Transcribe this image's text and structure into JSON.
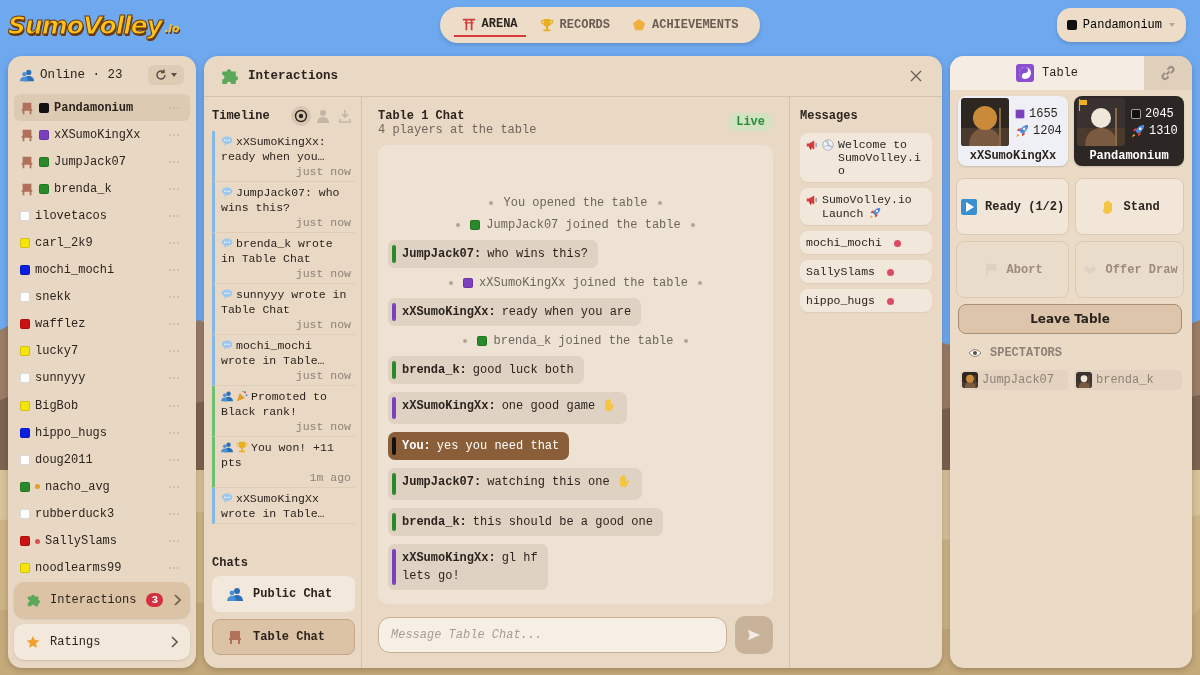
{
  "logo": {
    "name": "SumoVolley",
    "suffix": ".io"
  },
  "nav": [
    {
      "kind": "arena",
      "label": "ARENA",
      "selected": true
    },
    {
      "kind": "records",
      "label": "RECORDS",
      "selected": false
    },
    {
      "kind": "achievements",
      "label": "ACHIEVEMENTS",
      "selected": false
    }
  ],
  "account": {
    "name": "Pandamonium",
    "color": "#111111"
  },
  "online": {
    "title": "Online · 23"
  },
  "users": [
    {
      "name": "Pandamonium",
      "color": "#111111",
      "seated": true,
      "selected": true
    },
    {
      "name": "xXSumoKingXx",
      "color": "#7b3fbf",
      "seated": true,
      "selected": false
    },
    {
      "name": "JumpJack07",
      "color": "#2a8a2a",
      "seated": true,
      "selected": false
    },
    {
      "name": "brenda_k",
      "color": "#2a8a2a",
      "seated": true,
      "selected": false
    },
    {
      "name": "ilovetacos",
      "color": "#ffffff",
      "seated": false,
      "selected": false
    },
    {
      "name": "carl_2k9",
      "color": "#f5e50a",
      "seated": false,
      "selected": false
    },
    {
      "name": "mochi_mochi",
      "color": "#0a1fe0",
      "seated": false,
      "selected": false
    },
    {
      "name": "snekk",
      "color": "#ffffff",
      "seated": false,
      "selected": false
    },
    {
      "name": "wafflez",
      "color": "#cc1111",
      "seated": false,
      "selected": false
    },
    {
      "name": "lucky7",
      "color": "#f5e50a",
      "seated": false,
      "selected": false
    },
    {
      "name": "sunnyyy",
      "color": "#ffffff",
      "seated": false,
      "selected": false
    },
    {
      "name": "BigBob",
      "color": "#f5e50a",
      "seated": false,
      "selected": false
    },
    {
      "name": "hippo_hugs",
      "color": "#0a1fe0",
      "seated": false,
      "selected": false
    },
    {
      "name": "doug2011",
      "color": "#ffffff",
      "seated": false,
      "selected": false
    },
    {
      "name": "nacho_avg",
      "color": "#2a8a2a",
      "seated": false,
      "selected": false,
      "marker": {
        "color": "#e89a2a"
      }
    },
    {
      "name": "rubberduck3",
      "color": "#ffffff",
      "seated": false,
      "selected": false
    },
    {
      "name": "SallySlams",
      "color": "#cc1111",
      "seated": false,
      "selected": false,
      "marker": {
        "color": "#e05050"
      }
    },
    {
      "name": "noodlearms99",
      "color": "#f5e50a",
      "seated": false,
      "selected": false
    }
  ],
  "sidebar_nav": [
    {
      "kind": "interactions",
      "label": "Interactions",
      "badge": "3",
      "selected": true
    },
    {
      "kind": "ratings",
      "label": "Ratings",
      "selected": false
    }
  ],
  "interactions": {
    "title": "Interactions",
    "timeline": {
      "title": "Timeline",
      "filters": [
        {
          "kind": "all",
          "selected": true
        },
        {
          "kind": "people",
          "selected": false
        },
        {
          "kind": "download",
          "selected": false
        }
      ],
      "items": [
        {
          "kind": "chat",
          "text": "xXSumoKingXx: ready when you…",
          "time": "just now"
        },
        {
          "kind": "chat",
          "text": "JumpJack07: who wins this?",
          "time": "just now"
        },
        {
          "kind": "chat",
          "text": "brenda_k wrote in Table Chat",
          "time": "just now"
        },
        {
          "kind": "chat",
          "text": "sunnyyy wrote in Table Chat",
          "time": "just now"
        },
        {
          "kind": "chat",
          "text": "mochi_mochi wrote in Table…",
          "time": "just now"
        },
        {
          "kind": "promotion",
          "text": "Promoted to Black rank!",
          "time": "just now"
        },
        {
          "kind": "win",
          "text": "You won! +11 pts",
          "time": "1m ago"
        },
        {
          "kind": "chat",
          "text": "xXSumoKingXx wrote in Table…"
        }
      ]
    },
    "chats_title": "Chats",
    "chats": [
      {
        "kind": "public",
        "label": "Public Chat",
        "selected": false
      },
      {
        "kind": "table",
        "label": "Table Chat",
        "selected": true
      }
    ],
    "chat": {
      "title": "Table 1 Chat",
      "subtitle": "4 players at the table",
      "status": "Live",
      "placeholder": "Message Table Chat...",
      "feed": [
        {
          "kind": "system",
          "text": "You opened the table"
        },
        {
          "kind": "system",
          "color": "#2a8a2a",
          "text": "JumpJack07 joined the table"
        },
        {
          "kind": "message",
          "author": "JumpJack07:",
          "color": "#2a8a2a",
          "text": "who wins this?",
          "mine": false
        },
        {
          "kind": "system",
          "color": "#7b3fbf",
          "text": "xXSumoKingXx joined the table"
        },
        {
          "kind": "message",
          "author": "xXSumoKingXx:",
          "color": "#7b3fbf",
          "text": "ready when you are",
          "mine": false
        },
        {
          "kind": "system",
          "color": "#2a8a2a",
          "text": "brenda_k joined the table"
        },
        {
          "kind": "message",
          "author": "brenda_k:",
          "color": "#2a8a2a",
          "text": "good luck both",
          "mine": false
        },
        {
          "kind": "message",
          "author": "xXSumoKingXx:",
          "color": "#7b3fbf",
          "text": "one good game",
          "mine": false,
          "waved": true
        },
        {
          "kind": "message",
          "author": "You:",
          "color": "#111111",
          "text": "yes you need that",
          "mine": true
        },
        {
          "kind": "message",
          "author": "JumpJack07:",
          "color": "#2a8a2a",
          "text": "watching this one",
          "mine": false,
          "waved": true
        },
        {
          "kind": "message",
          "author": "brenda_k:",
          "color": "#2a8a2a",
          "text": "this should be a good one",
          "mine": false
        },
        {
          "kind": "message",
          "author": "xXSumoKingXx:",
          "color": "#7b3fbf",
          "text": "gl hf\nlets go!",
          "mine": false
        }
      ]
    },
    "messages": {
      "title": "Messages",
      "items": [
        {
          "kind": "welcome",
          "text": "Welcome to SumoVolley.io"
        },
        {
          "kind": "launch",
          "text": "SumoVolley.io Launch"
        },
        {
          "kind": "dm",
          "text": "mochi_mochi",
          "unread": true
        },
        {
          "kind": "dm",
          "text": "SallySlams",
          "unread": true
        },
        {
          "kind": "dm",
          "text": "hippo_hugs",
          "unread": true
        }
      ]
    }
  },
  "table": {
    "tabs": [
      {
        "kind": "table",
        "label": "Table",
        "selected": true
      },
      {
        "kind": "link",
        "selected": false
      }
    ],
    "players": [
      {
        "name": "xXSumoKingXx",
        "color": "#7b3fbf",
        "rating": "1655",
        "rockets": "1204",
        "selected": false,
        "host": false
      },
      {
        "name": "Pandamonium",
        "color": "#111111",
        "rating": "2045",
        "rockets": "1310",
        "selected": true,
        "host": true
      }
    ],
    "actions": [
      {
        "kind": "ready",
        "label": "Ready (1/2)",
        "disabled": false
      },
      {
        "kind": "stand",
        "label": "Stand",
        "disabled": false
      },
      {
        "kind": "abort",
        "label": "Abort",
        "disabled": true
      },
      {
        "kind": "draw",
        "label": "Offer Draw",
        "disabled": true
      }
    ],
    "leave": "Leave Table",
    "spectators_title": "SPECTATORS",
    "spectators": [
      {
        "name": "JumpJack07"
      },
      {
        "name": "brenda_k"
      }
    ]
  }
}
